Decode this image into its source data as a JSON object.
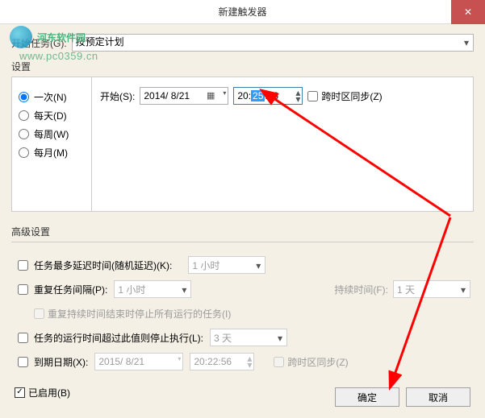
{
  "title": "新建触发器",
  "watermark_text": "河东软件园",
  "watermark_url": "www.pc0359.cn",
  "start_task_label": "开始任务(G):",
  "start_task_value": "按预定计划",
  "settings_label": "设置",
  "radios": {
    "once": "一次(N)",
    "daily": "每天(D)",
    "weekly": "每周(W)",
    "monthly": "每月(M)"
  },
  "start_label": "开始(S):",
  "start_date": "2014/ 8/21",
  "start_time_h": "20",
  "start_time_m": "25",
  "start_time_s": "56",
  "tz_sync": "跨时区同步(Z)",
  "adv_label": "高级设置",
  "delay_label": "任务最多延迟时间(随机延迟)(K):",
  "delay_value": "1 小时",
  "repeat_label": "重复任务间隔(P):",
  "repeat_value": "1 小时",
  "dur_label": "持续时间(F):",
  "dur_value": "1 天",
  "repeat_stop": "重复持续时间结束时停止所有运行的任务(I)",
  "timelimit_label": "任务的运行时间超过此值则停止执行(L):",
  "timelimit_value": "3 天",
  "expire_label": "到期日期(X):",
  "expire_date": "2015/ 8/21",
  "expire_time": "20:22:56",
  "tz_sync2": "跨时区同步(Z)",
  "enabled_label": "已启用(B)",
  "ok": "确定",
  "cancel": "取消"
}
